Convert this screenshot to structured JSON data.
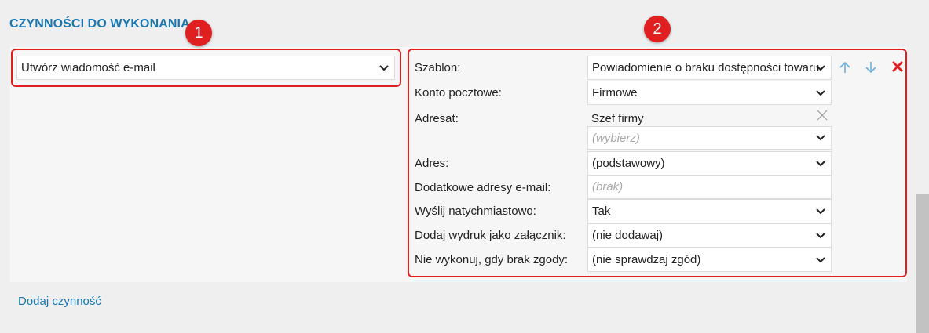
{
  "section": {
    "title": "CZYNNOŚCI DO WYKONANIA"
  },
  "badges": {
    "one": "1",
    "two": "2"
  },
  "action": {
    "selected": "Utwórz wiadomość e-mail"
  },
  "fields": {
    "szablon": {
      "label": "Szablon:",
      "value": "Powiadomienie o braku dostępności towaru"
    },
    "konto": {
      "label": "Konto pocztowe:",
      "value": "Firmowe"
    },
    "adresat": {
      "label": "Adresat:",
      "value": "Szef firmy",
      "select_placeholder": "(wybierz)"
    },
    "adres": {
      "label": "Adres:",
      "value": "(podstawowy)"
    },
    "dodatkowe": {
      "label": "Dodatkowe adresy e-mail:",
      "placeholder": "(brak)"
    },
    "wyslij": {
      "label": "Wyślij natychmiastowo:",
      "value": "Tak"
    },
    "wydruk": {
      "label": "Dodaj wydruk jako załącznik:",
      "value": "(nie dodawaj)"
    },
    "zgoda": {
      "label": "Nie wykonuj, gdy brak zgody:",
      "value": "(nie sprawdzaj zgód)"
    }
  },
  "links": {
    "add_action": "Dodaj czynność"
  },
  "icons": {
    "up": "arrow-up-icon",
    "down": "arrow-down-icon",
    "delete": "close-icon",
    "remove": "close-icon",
    "chevron": "chevron-down-icon"
  },
  "colors": {
    "accent": "#1a77b0",
    "highlight": "#e02020",
    "icon_light_blue": "#6ab0de"
  }
}
